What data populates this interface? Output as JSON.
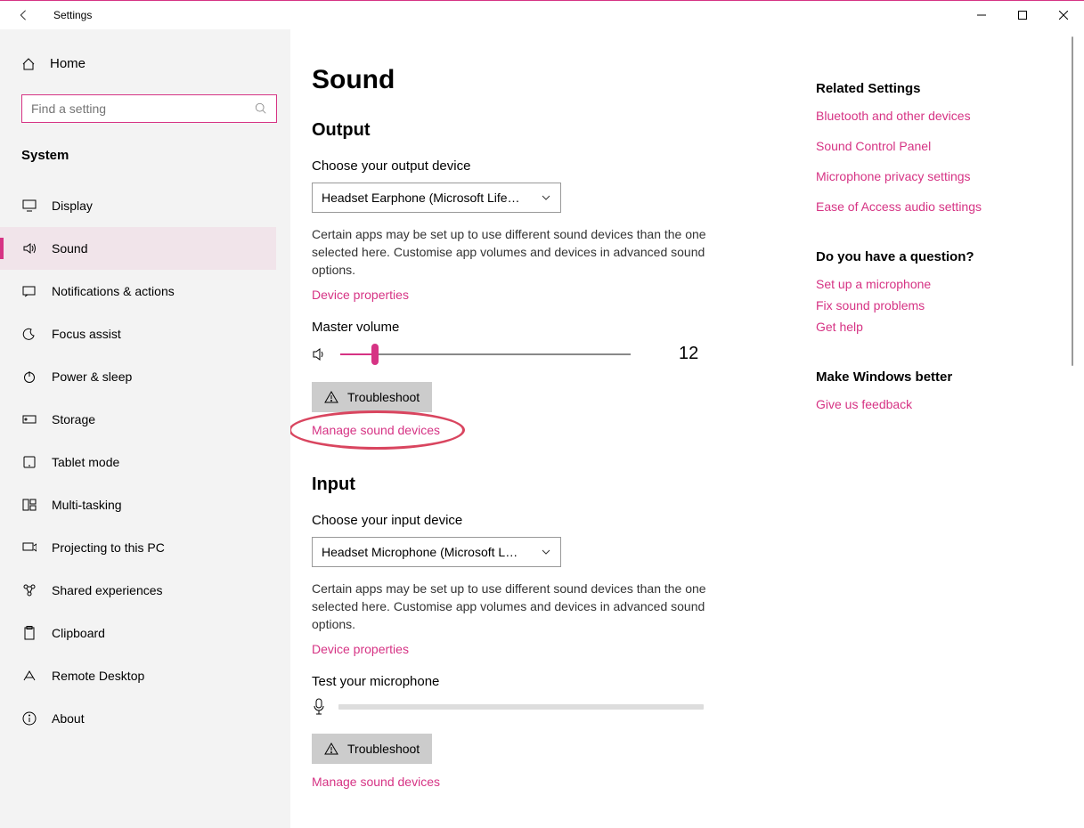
{
  "titlebar": {
    "title": "Settings"
  },
  "sidebar": {
    "home_label": "Home",
    "search_placeholder": "Find a setting",
    "section": "System",
    "items": [
      {
        "label": "Display"
      },
      {
        "label": "Sound"
      },
      {
        "label": "Notifications & actions"
      },
      {
        "label": "Focus assist"
      },
      {
        "label": "Power & sleep"
      },
      {
        "label": "Storage"
      },
      {
        "label": "Tablet mode"
      },
      {
        "label": "Multi-tasking"
      },
      {
        "label": "Projecting to this PC"
      },
      {
        "label": "Shared experiences"
      },
      {
        "label": "Clipboard"
      },
      {
        "label": "Remote Desktop"
      },
      {
        "label": "About"
      }
    ]
  },
  "main": {
    "page_title": "Sound",
    "output": {
      "heading": "Output",
      "choose_label": "Choose your output device",
      "device": "Headset Earphone (Microsoft Life…",
      "desc": "Certain apps may be set up to use different sound devices than the one selected here. Customise app volumes and devices in advanced sound options.",
      "device_properties": "Device properties",
      "master_volume_label": "Master volume",
      "volume_value": "12",
      "volume_percent": 12,
      "troubleshoot": "Troubleshoot",
      "manage_sound": "Manage sound devices"
    },
    "input": {
      "heading": "Input",
      "choose_label": "Choose your input device",
      "device": "Headset Microphone (Microsoft L…",
      "desc": "Certain apps may be set up to use different sound devices than the one selected here. Customise app volumes and devices in advanced sound options.",
      "device_properties": "Device properties",
      "test_label": "Test your microphone",
      "troubleshoot": "Troubleshoot",
      "manage_sound": "Manage sound devices"
    }
  },
  "right": {
    "related_heading": "Related Settings",
    "related_links": [
      "Bluetooth and other devices",
      "Sound Control Panel",
      "Microphone privacy settings",
      "Ease of Access audio settings"
    ],
    "question_heading": "Do you have a question?",
    "question_links": [
      "Set up a microphone",
      "Fix sound problems",
      "Get help"
    ],
    "better_heading": "Make Windows better",
    "feedback_link": "Give us feedback"
  }
}
